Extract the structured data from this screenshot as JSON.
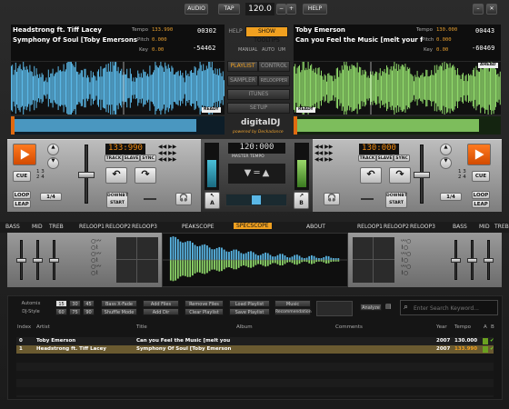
{
  "top_bar": {
    "audio": "AUDIO",
    "tap": "TAP",
    "bpm": "120.0",
    "minus": "−",
    "plus": "+",
    "help": "HELP",
    "min": "–",
    "close": "✕"
  },
  "deck_a": {
    "artist": "Headstrong ft. Tiff Lacey",
    "title": "Symphony Of Soul [Toby Emersons Elec",
    "tempo_label": "Tempo",
    "tempo": "133.990",
    "pitch_label": "Pitch",
    "pitch": "0.000",
    "key_label": "Key",
    "key": "0.00",
    "elapsed": "00302",
    "remain": "-54462",
    "status": "READY",
    "bpm_display": "133:990",
    "track": "TRACK",
    "slave": "SLAVE",
    "sync": "SYNC",
    "cue": "CUE",
    "loop": "LOOP",
    "leap": "LEAP",
    "loop_len": "1/4",
    "downbeat": "DOWNBT",
    "start": "START",
    "cue_nums": [
      "1",
      "2",
      "3",
      "4"
    ]
  },
  "deck_b": {
    "artist": "Toby Emerson",
    "title": "Can you Feel the Music [melt your face",
    "tempo_label": "Tempo",
    "tempo": "130.000",
    "pitch_label": "Pitch",
    "pitch": "0.000",
    "key_label": "Key",
    "key": "0.00",
    "elapsed": "00443",
    "remain": "-60469",
    "status": "READY",
    "ahead": "AHEAD",
    "bpm_display": "130:000",
    "track": "TRACK",
    "slave": "SLAVE",
    "sync": "SYNC",
    "cue": "CUE",
    "loop": "LOOP",
    "leap": "LEAP",
    "loop_len": "1/4",
    "downbeat": "DOWNBT",
    "start": "START",
    "cue_nums": [
      "1",
      "2",
      "3",
      "4"
    ]
  },
  "center": {
    "help": "HELP",
    "show_tooltips": "SHOW TOOLTIPS",
    "manual": "MANUAL",
    "auto": "AUTO",
    "um": "UM",
    "playlist": "PLAYLIST",
    "control": "CONTROL",
    "sampler": "SAMPLER",
    "reloopper": "RELOOPPER",
    "itunes": "ITUNES",
    "setup": "SETUP",
    "brand": "digitalDJ",
    "powered": "powered by Deckadance",
    "master_bpm": "120:000",
    "master_tempo": "MASTER TEMPO",
    "a": "A",
    "b": "B"
  },
  "fx_row": {
    "left": [
      "BASS",
      "MID",
      "TREB",
      "RELOOP1",
      "RELOOP2",
      "RELOOP3"
    ],
    "peakscope": "PEAKSCOPE",
    "specscope": "SPECSCOPE",
    "about": "ABOUT",
    "right": [
      "RELOOP1",
      "RELOOP2",
      "RELOOP3",
      "BASS",
      "MID",
      "TREB"
    ]
  },
  "browser": {
    "autosync": "Automix",
    "djstyle": "DJ-Style",
    "nums": [
      "15",
      "30",
      "45",
      "60",
      "75",
      "90"
    ],
    "bassxfade": "Bass X-Fade",
    "shufflemode": "Shuffle Mode",
    "addfiles": "Add Files",
    "adddir": "Add Dir",
    "removefiles": "Remove Files",
    "clearplaylist": "Clear Playlist",
    "loadplaylist": "Load Playlist",
    "saveplaylist": "Save Playlist",
    "music": "Music",
    "recommendation": "Recommendation",
    "analyze": "Analyze",
    "search_placeholder": "Enter Search Keyword...",
    "columns": {
      "index": "Index",
      "artist": "Artist",
      "title": "Title",
      "album": "Album",
      "comments": "Comments",
      "year": "Year",
      "tempo": "Tempo",
      "a": "A",
      "b": "B"
    },
    "rows": [
      {
        "index": "0",
        "artist": "Toby Emerson",
        "title": "Can you Feel the Music [melt you",
        "album": "",
        "comments": "",
        "year": "2007",
        "tempo": "130.000"
      },
      {
        "index": "1",
        "artist": "Headstrong ft. Tiff Lacey",
        "title": "Symphony Of Soul [Toby Emerson",
        "album": "",
        "comments": "",
        "year": "2007",
        "tempo": "133.990"
      }
    ]
  },
  "colors": {
    "accent": "#f0a020",
    "wave_a": "#5ab7e6",
    "wave_b": "#8fd86a"
  }
}
